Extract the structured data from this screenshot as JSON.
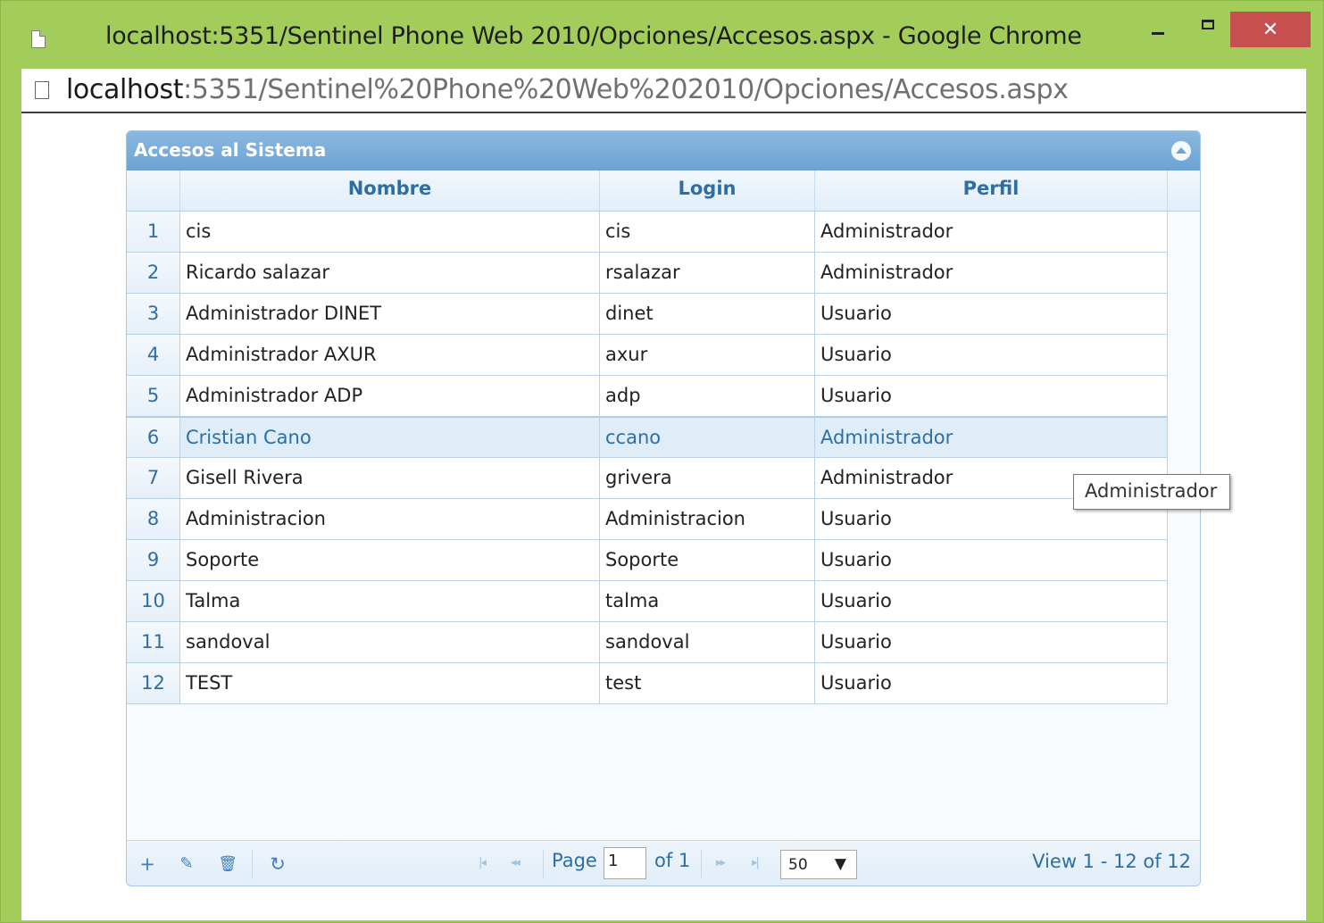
{
  "window": {
    "title": "localhost:5351/Sentinel Phone Web 2010/Opciones/Accesos.aspx - Google Chrome",
    "close_glyph": "✕"
  },
  "address": {
    "host": "localhost",
    "path": ":5351/Sentinel%20Phone%20Web%202010/Opciones/Accesos.aspx"
  },
  "grid": {
    "caption": "Accesos al Sistema",
    "columns": [
      "Nombre",
      "Login",
      "Perfil"
    ],
    "selected_row": 6,
    "rows": [
      {
        "n": "1",
        "nombre": "cis",
        "login": "cis",
        "perfil": "Administrador"
      },
      {
        "n": "2",
        "nombre": "Ricardo salazar",
        "login": "rsalazar",
        "perfil": "Administrador"
      },
      {
        "n": "3",
        "nombre": "Administrador DINET",
        "login": "dinet",
        "perfil": "Usuario"
      },
      {
        "n": "4",
        "nombre": "Administrador AXUR",
        "login": "axur",
        "perfil": "Usuario"
      },
      {
        "n": "5",
        "nombre": "Administrador ADP",
        "login": "adp",
        "perfil": "Usuario"
      },
      {
        "n": "6",
        "nombre": "Cristian Cano",
        "login": "ccano",
        "perfil": "Administrador"
      },
      {
        "n": "7",
        "nombre": "Gisell Rivera",
        "login": "grivera",
        "perfil": "Administrador"
      },
      {
        "n": "8",
        "nombre": "Administracion",
        "login": "Administracion",
        "perfil": "Usuario"
      },
      {
        "n": "9",
        "nombre": "Soporte",
        "login": "Soporte",
        "perfil": "Usuario"
      },
      {
        "n": "10",
        "nombre": "Talma",
        "login": "talma",
        "perfil": "Usuario"
      },
      {
        "n": "11",
        "nombre": "sandoval",
        "login": "sandoval",
        "perfil": "Usuario"
      },
      {
        "n": "12",
        "nombre": "TEST",
        "login": "test",
        "perfil": "Usuario"
      }
    ]
  },
  "pager": {
    "add_icon": "+",
    "edit_icon": "✎",
    "delete_icon": "🗑",
    "refresh_icon": "↻",
    "first_icon": "|◂",
    "prev_icon": "◂◂",
    "next_icon": "▸▸",
    "last_icon": "▸|",
    "page_label": "Page",
    "page_value": "1",
    "of_label": "of 1",
    "rows_per_page": "50",
    "select_arrow": "▼",
    "view_info": "View 1 - 12 of 12"
  },
  "tooltip": {
    "text": "Administrador"
  },
  "colors": {
    "frame": "#a3cd5b",
    "header_blue": "#6da3d3",
    "text_blue": "#2e6ea3",
    "close_red": "#c7504f",
    "selected_row": "#dfedf9"
  }
}
